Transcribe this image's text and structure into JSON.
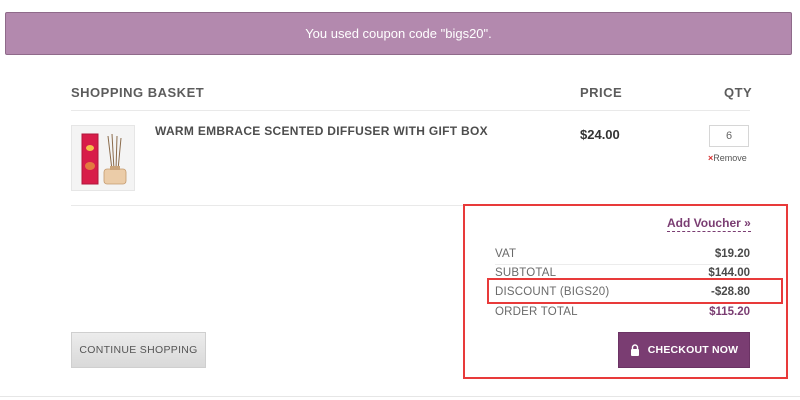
{
  "banner": {
    "message": "You used coupon code \"bigs20\"."
  },
  "basket": {
    "headers": {
      "item": "SHOPPING BASKET",
      "price": "PRICE",
      "qty": "QTY"
    },
    "items": [
      {
        "name": "WARM EMBRACE SCENTED DIFFUSER WITH GIFT BOX",
        "price": "$24.00",
        "qty": "6",
        "remove_icon": "×",
        "remove_label": "Remove",
        "image_icon": "diffuser-product-image"
      }
    ]
  },
  "summary": {
    "add_voucher_label": "Add Voucher »",
    "rows": [
      {
        "label": "VAT",
        "value": "$19.20"
      },
      {
        "label": "SUBTOTAL",
        "value": "$144.00"
      },
      {
        "label": "DISCOUNT (BIGS20)",
        "value": "-$28.80"
      },
      {
        "label": "ORDER TOTAL",
        "value": "$115.20"
      }
    ]
  },
  "actions": {
    "continue_label": "CONTINUE SHOPPING",
    "checkout_label": "CHECKOUT NOW",
    "checkout_icon": "lock-icon"
  },
  "colors": {
    "accent": "#7a3d72",
    "banner": "#b389ae",
    "highlight_frame": "#e83a3a"
  }
}
